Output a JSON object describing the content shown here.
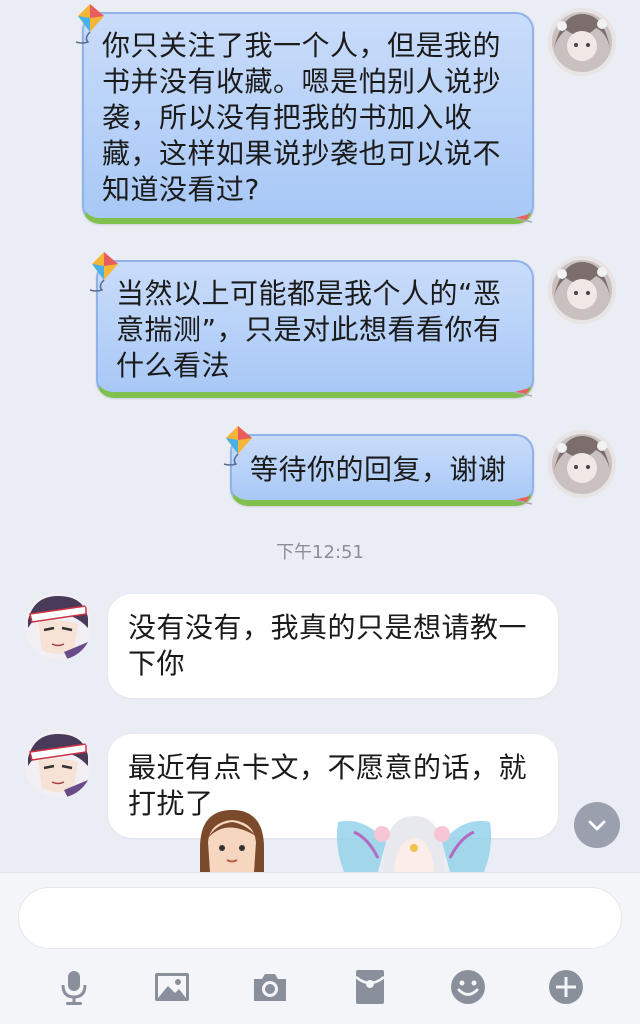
{
  "messages": {
    "sent": [
      {
        "text": "你只关注了我一个人，但是我的书并没有收藏。嗯是怕别人说抄袭，所以没有把我的书加入收藏，这样如果说抄袭也可以说不知道没看过?"
      },
      {
        "text": "当然以上可能都是我个人的“恶意揣测”，只是对此想看看你有什么看法"
      },
      {
        "text": "等待你的回复，谢谢"
      }
    ],
    "timestamp": "下午12:51",
    "received": [
      {
        "text": "没有没有，我真的只是想请教一下你"
      },
      {
        "text": "最近有点卡文，不愿意的话，就打扰了"
      }
    ]
  },
  "composer": {
    "placeholder": "",
    "icons": [
      "microphone-icon",
      "image-icon",
      "camera-icon",
      "red-packet-icon",
      "emoji-icon",
      "plus-icon"
    ]
  },
  "colors": {
    "background": "#ebedf5",
    "sent_bubble": "#b4d0f8",
    "sent_bubble_bottom": "#7fc04e",
    "received_bubble": "#ffffff",
    "icon": "#8a8f9c"
  }
}
